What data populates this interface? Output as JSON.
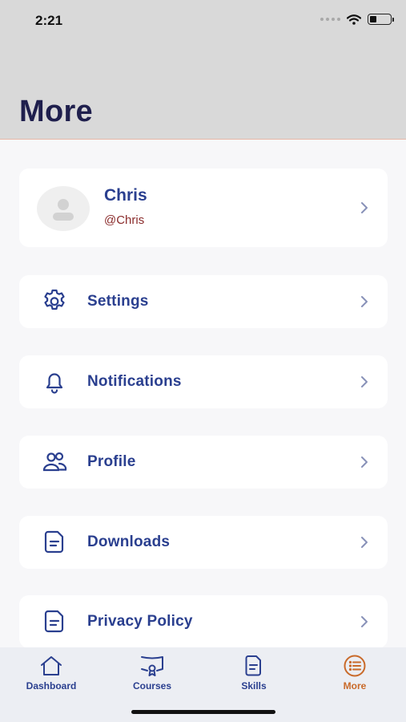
{
  "status_bar": {
    "time": "2:21"
  },
  "header": {
    "title": "More"
  },
  "profile": {
    "name": "Chris",
    "handle": "@Chris"
  },
  "menu": {
    "items": [
      {
        "label": "Settings",
        "icon": "gear-icon"
      },
      {
        "label": "Notifications",
        "icon": "bell-icon"
      },
      {
        "label": "Profile",
        "icon": "users-icon"
      },
      {
        "label": "Downloads",
        "icon": "document-icon"
      },
      {
        "label": "Privacy Policy",
        "icon": "document-icon"
      }
    ]
  },
  "tabbar": {
    "tabs": [
      {
        "label": "Dashboard",
        "icon": "home-icon"
      },
      {
        "label": "Courses",
        "icon": "certificate-icon"
      },
      {
        "label": "Skills",
        "icon": "document-icon"
      },
      {
        "label": "More",
        "icon": "list-icon",
        "active": true
      }
    ]
  },
  "colors": {
    "accent": "#2a3f8f",
    "active_tab": "#c96a2a",
    "title": "#1f1f4d",
    "handle": "#8a2b2b"
  }
}
